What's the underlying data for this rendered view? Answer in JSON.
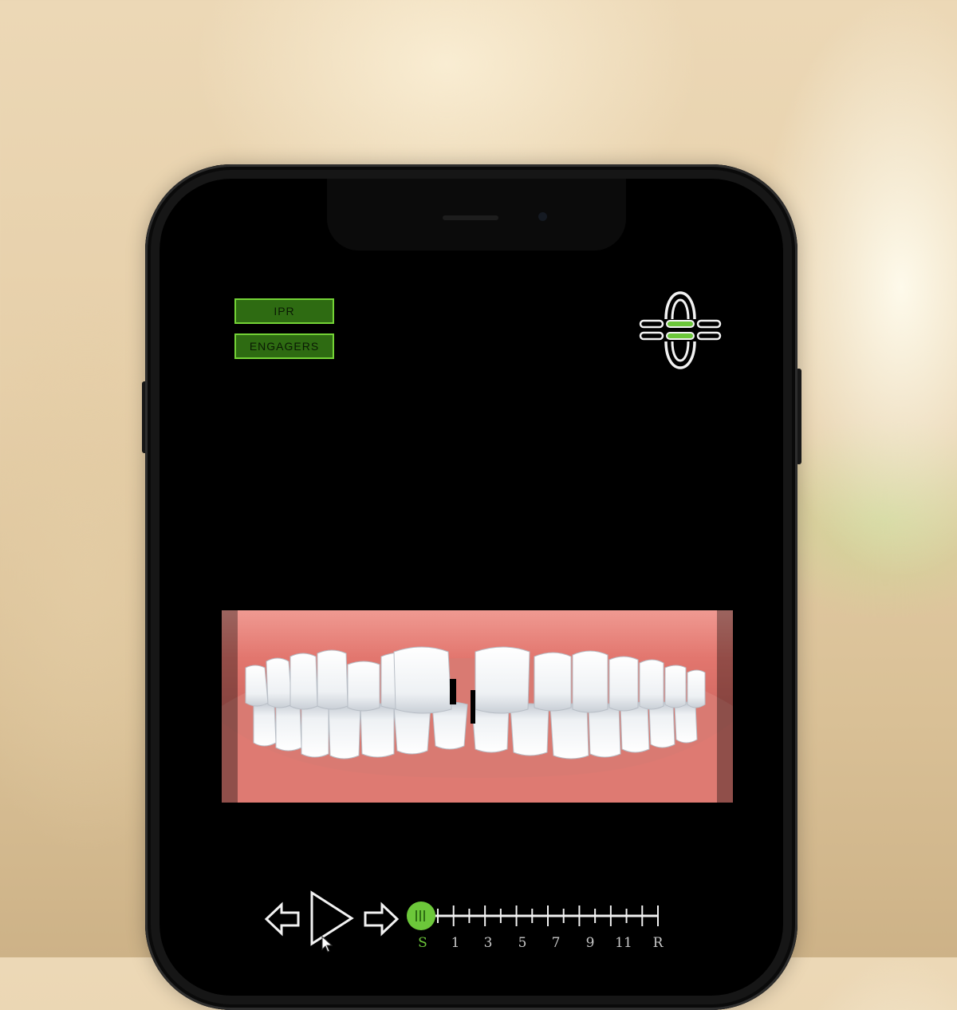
{
  "toolbar": {
    "ipr_label": "IPR",
    "engagers_label": "ENGAGERS"
  },
  "jaw_toggle": {
    "icon": "jaw-view-icon",
    "active_color": "#6cc73a"
  },
  "playback": {
    "back_icon": "arrow-left-icon",
    "play_icon": "play-icon",
    "forward_icon": "arrow-right-icon"
  },
  "timeline": {
    "labels": [
      "S",
      "1",
      "3",
      "5",
      "7",
      "9",
      "11",
      "R"
    ],
    "current_label": "S",
    "accent_color": "#6cc73a"
  },
  "viewer": {
    "content": "3d-dental-model"
  }
}
